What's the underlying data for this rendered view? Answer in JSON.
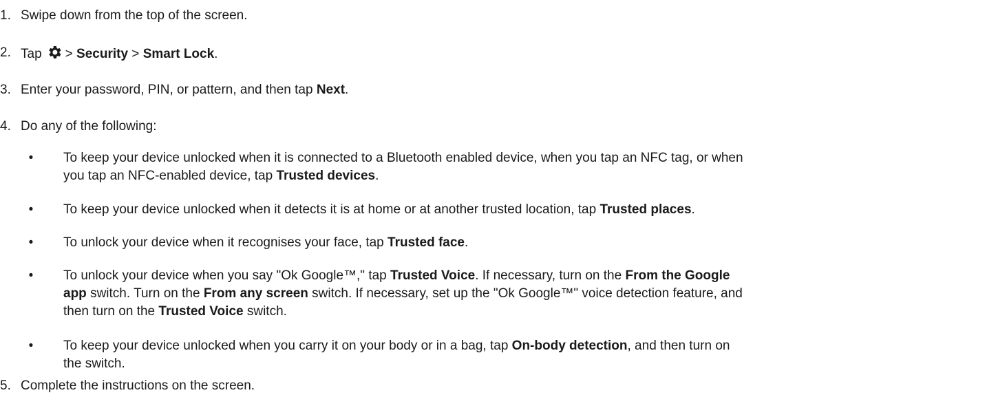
{
  "steps": [
    {
      "number": "1.",
      "text": "Swipe down from the top of the screen."
    },
    {
      "number": "2.",
      "prefix": "Tap",
      "icon": "gear-icon",
      "sep1": ">",
      "bold1": "Security",
      "sep2": ">",
      "bold2": "Smart Lock",
      "end": "."
    },
    {
      "number": "3.",
      "text": "Enter your password, PIN, or pattern, and then tap",
      "bold": "Next",
      "end": "."
    },
    {
      "number": "4.",
      "text": "Do any of the following:"
    },
    {
      "number": "5.",
      "text": "Complete the instructions on the screen."
    }
  ],
  "bullets": [
    {
      "symbol": "•",
      "line1": "To keep your device unlocked when it is connected to a Bluetooth enabled device, when you tap an NFC tag, or when",
      "line2_pre": "you tap an NFC-enabled device, tap",
      "bold": "Trusted devices",
      "end": "."
    },
    {
      "symbol": "•",
      "pre": "To keep your device unlocked when it detects it is at home or at another trusted location, tap",
      "bold": "Trusted places",
      "end": "."
    },
    {
      "symbol": "•",
      "pre": "To unlock your device when it recognises your face, tap",
      "bold": "Trusted face",
      "end": "."
    },
    {
      "symbol": "•",
      "l1_pre": "To unlock your device when you say \"Ok Google™,\" tap",
      "l1_bold1": "Trusted Voice",
      "l1_mid": ". If necessary, turn on the",
      "l1_bold2": "From the Google",
      "l2_bold": "app",
      "l2_mid1": "switch. Turn on the",
      "l2_bold2": "From any screen",
      "l2_end": "switch. If necessary, set up the \"Ok Google™\" voice detection feature, and",
      "l3_pre": "then turn on the",
      "l3_bold": "Trusted Voice",
      "l3_end": "switch."
    },
    {
      "symbol": "•",
      "line1_pre": "To keep your device unlocked when you carry it on your body or in a bag, tap",
      "bold": "On-body detection",
      "line1_end": ", and then turn on",
      "line2": "the switch."
    }
  ]
}
